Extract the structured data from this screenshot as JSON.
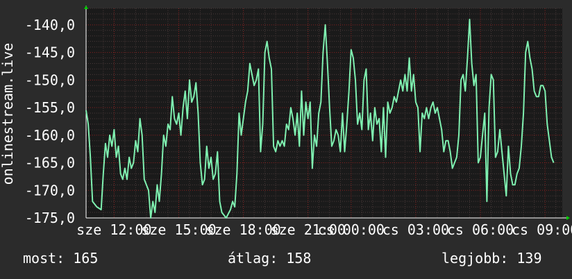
{
  "colors": {
    "background": "#2b2b2b",
    "plot_background": "#1a1a1a",
    "grid_major": "#8b2020",
    "grid_minor": "#4a3a3a",
    "line": "#7ff0b0",
    "axis_arrow": "#00cc00",
    "text": "#ffffff"
  },
  "chart_data": {
    "type": "line",
    "title": "",
    "ylabel": "onlinestream.live",
    "ylim": [
      -175,
      -137
    ],
    "y_ticks": [
      -140,
      -145,
      -150,
      -155,
      -160,
      -165,
      -170,
      -175
    ],
    "y_tick_labels": [
      "-140,0",
      "-145,0",
      "-150,0",
      "-155,0",
      "-160,0",
      "-165,0",
      "-170,0",
      "-175,0"
    ],
    "x_range": [
      11.7,
      33.8
    ],
    "x_tick_labels": [
      {
        "x": 13,
        "label": "sze 12:00"
      },
      {
        "x": 16,
        "label": "sze 15:00"
      },
      {
        "x": 19,
        "label": "sze 18:00"
      },
      {
        "x": 22,
        "label": "sze 21:00"
      },
      {
        "x": 24,
        "label": "cs 00:00"
      },
      {
        "x": 27,
        "label": "cs 03:00"
      },
      {
        "x": 30,
        "label": "cs 06:00"
      },
      {
        "x": 33,
        "label": "cs 09:00"
      }
    ],
    "series": [
      {
        "values": [
          [
            11.7,
            -155.5
          ],
          [
            11.8,
            -158
          ],
          [
            11.9,
            -164
          ],
          [
            12.0,
            -172
          ],
          [
            12.2,
            -173
          ],
          [
            12.4,
            -173.5
          ],
          [
            12.5,
            -167
          ],
          [
            12.6,
            -161.5
          ],
          [
            12.7,
            -164
          ],
          [
            12.8,
            -160
          ],
          [
            12.9,
            -162
          ],
          [
            13.0,
            -159
          ],
          [
            13.1,
            -164
          ],
          [
            13.2,
            -162
          ],
          [
            13.3,
            -167
          ],
          [
            13.4,
            -168
          ],
          [
            13.5,
            -166
          ],
          [
            13.6,
            -168
          ],
          [
            13.7,
            -164
          ],
          [
            13.8,
            -166
          ],
          [
            13.9,
            -165
          ],
          [
            14.0,
            -161
          ],
          [
            14.1,
            -163
          ],
          [
            14.2,
            -157
          ],
          [
            14.3,
            -160
          ],
          [
            14.4,
            -168
          ],
          [
            14.6,
            -170
          ],
          [
            14.7,
            -175
          ],
          [
            14.8,
            -172
          ],
          [
            14.9,
            -174
          ],
          [
            15.0,
            -169
          ],
          [
            15.1,
            -172
          ],
          [
            15.2,
            -167
          ],
          [
            15.3,
            -160
          ],
          [
            15.4,
            -162
          ],
          [
            15.5,
            -158
          ],
          [
            15.6,
            -159
          ],
          [
            15.7,
            -153
          ],
          [
            15.8,
            -157
          ],
          [
            15.9,
            -158
          ],
          [
            16.0,
            -156
          ],
          [
            16.1,
            -160
          ],
          [
            16.2,
            -155
          ],
          [
            16.3,
            -152
          ],
          [
            16.4,
            -157
          ],
          [
            16.5,
            -150
          ],
          [
            16.6,
            -154
          ],
          [
            16.7,
            -153
          ],
          [
            16.8,
            -150.5
          ],
          [
            16.9,
            -156
          ],
          [
            17.0,
            -165
          ],
          [
            17.1,
            -169
          ],
          [
            17.2,
            -168
          ],
          [
            17.3,
            -162
          ],
          [
            17.4,
            -166
          ],
          [
            17.5,
            -164
          ],
          [
            17.6,
            -168
          ],
          [
            17.7,
            -167
          ],
          [
            17.8,
            -163
          ],
          [
            17.9,
            -172
          ],
          [
            18.0,
            -174
          ],
          [
            18.2,
            -175
          ],
          [
            18.4,
            -173.5
          ],
          [
            18.5,
            -172
          ],
          [
            18.6,
            -173
          ],
          [
            18.7,
            -167
          ],
          [
            18.8,
            -156
          ],
          [
            18.9,
            -160
          ],
          [
            19.0,
            -157
          ],
          [
            19.1,
            -154
          ],
          [
            19.2,
            -152
          ],
          [
            19.3,
            -147
          ],
          [
            19.4,
            -149
          ],
          [
            19.5,
            -151
          ],
          [
            19.6,
            -150
          ],
          [
            19.7,
            -148
          ],
          [
            19.8,
            -163
          ],
          [
            19.9,
            -158
          ],
          [
            20.0,
            -145
          ],
          [
            20.1,
            -143
          ],
          [
            20.2,
            -146
          ],
          [
            20.3,
            -148
          ],
          [
            20.4,
            -162
          ],
          [
            20.5,
            -163
          ],
          [
            20.6,
            -161
          ],
          [
            20.7,
            -162
          ],
          [
            20.8,
            -161
          ],
          [
            20.9,
            -162
          ],
          [
            21.0,
            -158
          ],
          [
            21.1,
            -159
          ],
          [
            21.2,
            -155
          ],
          [
            21.3,
            -157
          ],
          [
            21.4,
            -160
          ],
          [
            21.5,
            -156
          ],
          [
            21.6,
            -162
          ],
          [
            21.7,
            -152
          ],
          [
            21.8,
            -160
          ],
          [
            21.9,
            -154
          ],
          [
            22.0,
            -157
          ],
          [
            22.1,
            -154
          ],
          [
            22.2,
            -166
          ],
          [
            22.3,
            -160
          ],
          [
            22.4,
            -162
          ],
          [
            22.5,
            -156
          ],
          [
            22.6,
            -154
          ],
          [
            22.7,
            -145
          ],
          [
            22.8,
            -140
          ],
          [
            22.9,
            -147
          ],
          [
            23.0,
            -155
          ],
          [
            23.1,
            -162
          ],
          [
            23.2,
            -161
          ],
          [
            23.3,
            -159
          ],
          [
            23.4,
            -160
          ],
          [
            23.5,
            -163
          ],
          [
            23.6,
            -156
          ],
          [
            23.7,
            -163
          ],
          [
            23.8,
            -158
          ],
          [
            23.9,
            -152
          ],
          [
            24.0,
            -144.5
          ],
          [
            24.1,
            -146
          ],
          [
            24.2,
            -150
          ],
          [
            24.3,
            -158
          ],
          [
            24.4,
            -156
          ],
          [
            24.5,
            -159
          ],
          [
            24.6,
            -150
          ],
          [
            24.7,
            -148
          ],
          [
            24.8,
            -159
          ],
          [
            24.9,
            -156
          ],
          [
            25.0,
            -161
          ],
          [
            25.1,
            -155
          ],
          [
            25.2,
            -158
          ],
          [
            25.3,
            -157
          ],
          [
            25.4,
            -163
          ],
          [
            25.5,
            -155
          ],
          [
            25.6,
            -164
          ],
          [
            25.7,
            -154
          ],
          [
            25.8,
            -156
          ],
          [
            25.9,
            -155
          ],
          [
            26.0,
            -153
          ],
          [
            26.1,
            -154
          ],
          [
            26.2,
            -152
          ],
          [
            26.3,
            -150
          ],
          [
            26.4,
            -152
          ],
          [
            26.5,
            -149
          ],
          [
            26.6,
            -152
          ],
          [
            26.7,
            -146
          ],
          [
            26.8,
            -152
          ],
          [
            26.9,
            -149
          ],
          [
            27.0,
            -154
          ],
          [
            27.1,
            -155
          ],
          [
            27.2,
            -163
          ],
          [
            27.3,
            -156
          ],
          [
            27.4,
            -157
          ],
          [
            27.5,
            -155
          ],
          [
            27.6,
            -157
          ],
          [
            27.7,
            -155
          ],
          [
            27.8,
            -154
          ],
          [
            27.9,
            -156
          ],
          [
            28.0,
            -155
          ],
          [
            28.1,
            -157
          ],
          [
            28.2,
            -159
          ],
          [
            28.3,
            -163
          ],
          [
            28.4,
            -161
          ],
          [
            28.5,
            -161
          ],
          [
            28.6,
            -163
          ],
          [
            28.7,
            -166
          ],
          [
            28.8,
            -165
          ],
          [
            28.9,
            -164
          ],
          [
            29.0,
            -160
          ],
          [
            29.1,
            -150
          ],
          [
            29.2,
            -149
          ],
          [
            29.3,
            -152
          ],
          [
            29.4,
            -146
          ],
          [
            29.5,
            -139
          ],
          [
            29.6,
            -147
          ],
          [
            29.7,
            -151
          ],
          [
            29.8,
            -149
          ],
          [
            29.9,
            -165
          ],
          [
            30.0,
            -164
          ],
          [
            30.1,
            -160
          ],
          [
            30.2,
            -156
          ],
          [
            30.3,
            -172
          ],
          [
            30.4,
            -155
          ],
          [
            30.5,
            -149
          ],
          [
            30.6,
            -150
          ],
          [
            30.7,
            -164
          ],
          [
            30.8,
            -163
          ],
          [
            30.9,
            -159
          ],
          [
            31.0,
            -163
          ],
          [
            31.1,
            -167
          ],
          [
            31.2,
            -171
          ],
          [
            31.3,
            -162
          ],
          [
            31.4,
            -167
          ],
          [
            31.5,
            -169
          ],
          [
            31.6,
            -169
          ],
          [
            31.7,
            -167
          ],
          [
            31.8,
            -166
          ],
          [
            31.9,
            -162
          ],
          [
            32.0,
            -156
          ],
          [
            32.1,
            -145
          ],
          [
            32.2,
            -143
          ],
          [
            32.3,
            -146
          ],
          [
            32.4,
            -148
          ],
          [
            32.5,
            -152
          ],
          [
            32.6,
            -153
          ],
          [
            32.7,
            -153
          ],
          [
            32.8,
            -151
          ],
          [
            32.9,
            -151
          ],
          [
            33.0,
            -152
          ],
          [
            33.1,
            -158
          ],
          [
            33.2,
            -161
          ],
          [
            33.3,
            -164
          ],
          [
            33.4,
            -165
          ]
        ]
      }
    ],
    "grid": true
  },
  "stats": {
    "now": "most: 165",
    "avg": "átlag: 158",
    "best": "legjobb: 139"
  }
}
